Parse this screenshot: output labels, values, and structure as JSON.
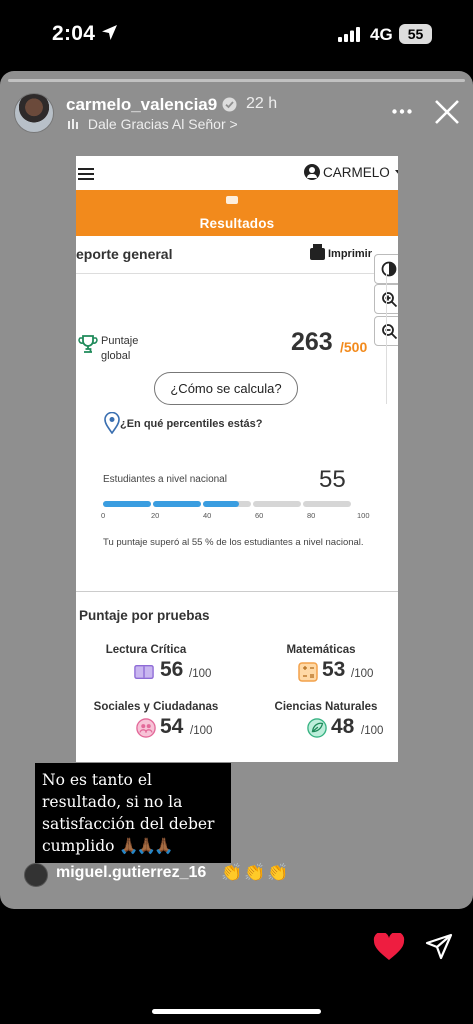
{
  "status_bar": {
    "time": "2:04",
    "network": "4G",
    "battery": "55"
  },
  "story": {
    "username": "carmelo_valencia9",
    "time_ago": "22 h",
    "music": "Dale Gracias Al Señor",
    "music_chevron": ">",
    "caption_text": "No es tanto el resultado, si no la satisfacción del deber cumplido",
    "caption_emoji": "🙏🏾🙏🏾🙏🏾",
    "mention": "miguel.gutierrez_16",
    "mention_emoji": "👏👏👏"
  },
  "screenshot": {
    "user_menu": "CARMELO",
    "header_title": "Resultados",
    "report_title": "eporte general",
    "print_label": "Imprimir",
    "score_label_line1": "Puntaje",
    "score_label_line2": "global",
    "score_value": "263",
    "score_max": "/500",
    "calc_button": "¿Cómo se calcula?",
    "percentile_question": "¿En qué percentiles estás?",
    "national_label": "Estudiantes a nivel nacional",
    "national_value": "55",
    "percentile_fill": 55,
    "ticks": [
      "0",
      "20",
      "40",
      "60",
      "80",
      "100"
    ],
    "percentile_text": "Tu puntaje superó al 55 % de los estudiantes a nivel nacional.",
    "tests_title": "Puntaje por pruebas",
    "subjects": [
      {
        "name": "Lectura Crítica",
        "score": "56",
        "max": "/100",
        "icon": "book-icon",
        "color": "#8e6bd6"
      },
      {
        "name": "Matemáticas",
        "score": "53",
        "max": "/100",
        "icon": "calculator-icon",
        "color": "#f2a14a"
      },
      {
        "name": "Sociales y Ciudadanas",
        "score": "54",
        "max": "/100",
        "icon": "people-icon",
        "color": "#e36a9a"
      },
      {
        "name": "Ciencias Naturales",
        "score": "48",
        "max": "/100",
        "icon": "leaf-icon",
        "color": "#39b383"
      }
    ]
  },
  "colors": {
    "accent": "#f28a1c",
    "bar_fill": "#3a9de0",
    "bar_empty": "#d6d6d6",
    "heart": "#ee1d40"
  }
}
